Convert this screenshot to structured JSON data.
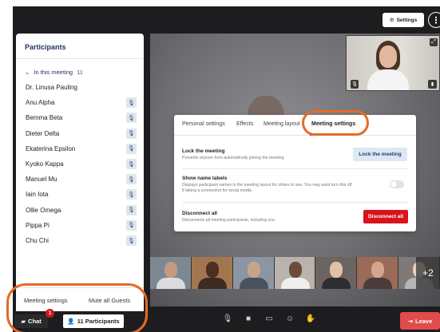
{
  "topbar": {
    "settings_label": "Settings",
    "more_icon": "more-vertical-icon"
  },
  "participants_panel": {
    "title": "Participants",
    "group_label": "In this meeting",
    "group_count": "11",
    "participants": [
      {
        "name": "Dr. Linusa Pauling",
        "muted": false
      },
      {
        "name": "Anu Alpha",
        "muted": true
      },
      {
        "name": "Bemma Beta",
        "muted": true
      },
      {
        "name": "Dieter Delta",
        "muted": true
      },
      {
        "name": "Ekaterina Epsilon",
        "muted": true
      },
      {
        "name": "Kyoko Kappa",
        "muted": true
      },
      {
        "name": "Manuel Mu",
        "muted": true
      },
      {
        "name": "Iain Iota",
        "muted": true
      },
      {
        "name": "Ollie Omega",
        "muted": true
      },
      {
        "name": "Pippa Pi",
        "muted": true
      },
      {
        "name": "Chu Chi",
        "muted": true
      }
    ],
    "footer": {
      "meeting_settings": "Meeting settings",
      "mute_all": "Mute all Guests"
    }
  },
  "bottom_bar": {
    "chat_label": "Chat",
    "chat_badge": "1",
    "participants_label": "11 Participants",
    "leave_label": "Leave"
  },
  "dialog": {
    "tabs": [
      "Personal settings",
      "Effects",
      "Meeting layout",
      "Meeting settings"
    ],
    "active_tab": "Meeting settings",
    "rows": {
      "lock": {
        "title": "Lock the meeting",
        "desc": "Prevents anyone from automatically joining the meeting",
        "button": "Lock the meeting"
      },
      "names": {
        "title": "Show name labels",
        "desc": "Displays participant names in the meeting layout for others to see. You may want turn this off if taking a screenshot for social media",
        "enabled": false
      },
      "disconnect": {
        "title": "Disconnect all",
        "desc": "Disconnects all meeting participants, including you",
        "button": "Disconnect all"
      }
    }
  },
  "thumbnails": {
    "more_count": "+2"
  },
  "colors": {
    "accent": "#2f6fd9",
    "danger": "#d7141d",
    "highlight_ring": "#e66a25",
    "panel_title": "#1f3358"
  }
}
